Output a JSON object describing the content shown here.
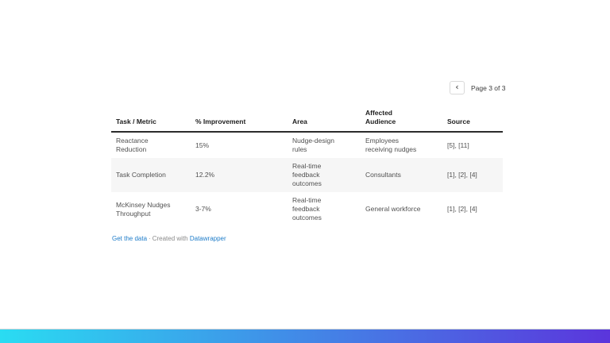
{
  "pagination": {
    "prev_icon": "‹",
    "label": "Page 3 of 3"
  },
  "chart_data": {
    "type": "table",
    "title": "",
    "columns": [
      "Task / Metric",
      "% Improvement",
      "Area",
      "Affected Audience",
      "Source"
    ],
    "rows": [
      [
        "Reactance Reduction",
        "15%",
        "Nudge-design rules",
        "Employees receiving nudges",
        "[5], [11]"
      ],
      [
        "Task Completion",
        "12.2%",
        "Real-time feedback outcomes",
        "Consultants",
        "[1], [2], [4]"
      ],
      [
        "McKinsey Nudges Throughput",
        "3-7%",
        "Real-time feedback outcomes",
        "General workforce",
        "[1], [2], [4]"
      ]
    ],
    "pagination": "Page 3 of 3",
    "layout_hints": {
      "zebra_striping": true,
      "striped_rows": "even"
    }
  },
  "table_display": {
    "headers": [
      "Task / Metric",
      "% Improvement",
      "Area",
      "Affected\nAudience",
      "Source"
    ],
    "rows": [
      [
        "Reactance\nReduction",
        "15%",
        "Nudge-design\nrules",
        "Employees\nreceiving nudges",
        "[5], [11]"
      ],
      [
        "Task Completion",
        "12.2%",
        "Real-time\nfeedback\noutcomes",
        "Consultants",
        "[1], [2], [4]"
      ],
      [
        "McKinsey Nudges\nThroughput",
        "3-7%",
        "Real-time\nfeedback\noutcomes",
        "General workforce",
        "[1], [2], [4]"
      ]
    ]
  },
  "footer": {
    "get_data_label": "Get the data",
    "separator": "·",
    "created_with": "Created with",
    "brand": "Datawrapper"
  },
  "colors": {
    "accent_gradient_start": "#2adcf2",
    "accent_gradient_end": "#5b35dc",
    "link": "#1e7cc9",
    "zebra_row": "#f6f6f6",
    "header_border": "#2b2b2b",
    "header_text": "#1d1d1d",
    "body_text": "#515151"
  }
}
